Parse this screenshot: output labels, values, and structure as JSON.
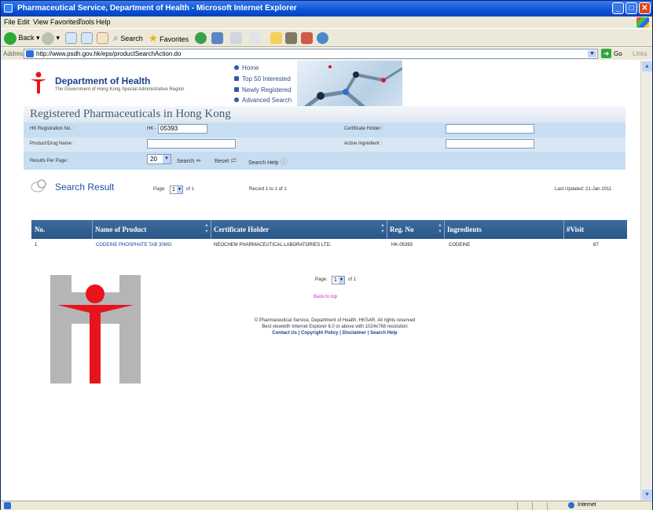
{
  "window": {
    "title": "Pharmaceutical Service, Department of Health - Microsoft Internet Explorer",
    "controls": {
      "minimize": "_",
      "maximize": "□",
      "close": "✕"
    }
  },
  "menu": [
    "File",
    "Edit",
    "View",
    "Favorites",
    "Tools",
    "Help"
  ],
  "toolbar": {
    "back_label": "Back",
    "search_label": "Search",
    "favorites_label": "Favorites"
  },
  "address": {
    "label": "Address",
    "url": "http://www.psdh.gov.hk/eps/productSearchAction.do",
    "go_label": "Go",
    "links_label": "Links"
  },
  "header": {
    "dept_name": "Department of Health",
    "dept_subtitle": "The Government of Hong Kong Special Administrative Region",
    "nav": [
      "Home",
      "Top 50 Interested",
      "Newly Registered",
      "Advanced Search"
    ],
    "page_title": "Registered Pharmaceuticals in Hong Kong"
  },
  "form": {
    "reg_no_label": "HK Registration No. :",
    "reg_no_prefix": "HK -",
    "reg_no_value": "05393",
    "holder_label": "Certificate Holder :",
    "holder_value": "",
    "product_label": "Product/Drug Name :",
    "product_value": "",
    "ingredient_label": "Active Ingredient :",
    "ingredient_value": "",
    "per_page_label": "Results Per Page :",
    "per_page_value": "20",
    "search_button": "Search",
    "reset_button": "Reset",
    "help_button": "Search Help"
  },
  "results": {
    "title": "Search Result",
    "page_label": "Page:",
    "page_value": "1",
    "page_of": "of 1",
    "record_text": "Record 1 to 1 of 1",
    "last_updated": "Last Updated: 21-Jan-2011",
    "columns": [
      "No.",
      "Name of Product",
      "Certificate Holder",
      "Reg. No",
      "Ingredients",
      "#Visit"
    ],
    "rows": [
      {
        "no": "1",
        "product": "CODEINE PHOSPHATE TAB 30MG",
        "holder": "NEOCHEM PHARMACEUTICAL LABORATORIES LTD.",
        "reg_no": "HK-05393",
        "ingredients": "CODEINE",
        "visits": "67"
      }
    ]
  },
  "footer": {
    "page_label": "Page:",
    "page_value": "1",
    "page_of": "of 1",
    "back_to_top": "Back to top",
    "copyright": "© Pharmaceutical Service, Department of Health, HKSAR. All rights reserved",
    "best_view": "Best viewwith Internet Explorer 6.0 or above with 1024x768 resolution",
    "links": "Contact Us | Copyright Policy | Disclaimer | Search Help"
  },
  "status": {
    "zone": "Internet"
  },
  "colors": {
    "table_header": "#2a5688",
    "form_bg": "#c6ddf2",
    "logo_red": "#e8141c",
    "link_pink": "#e020c0"
  }
}
